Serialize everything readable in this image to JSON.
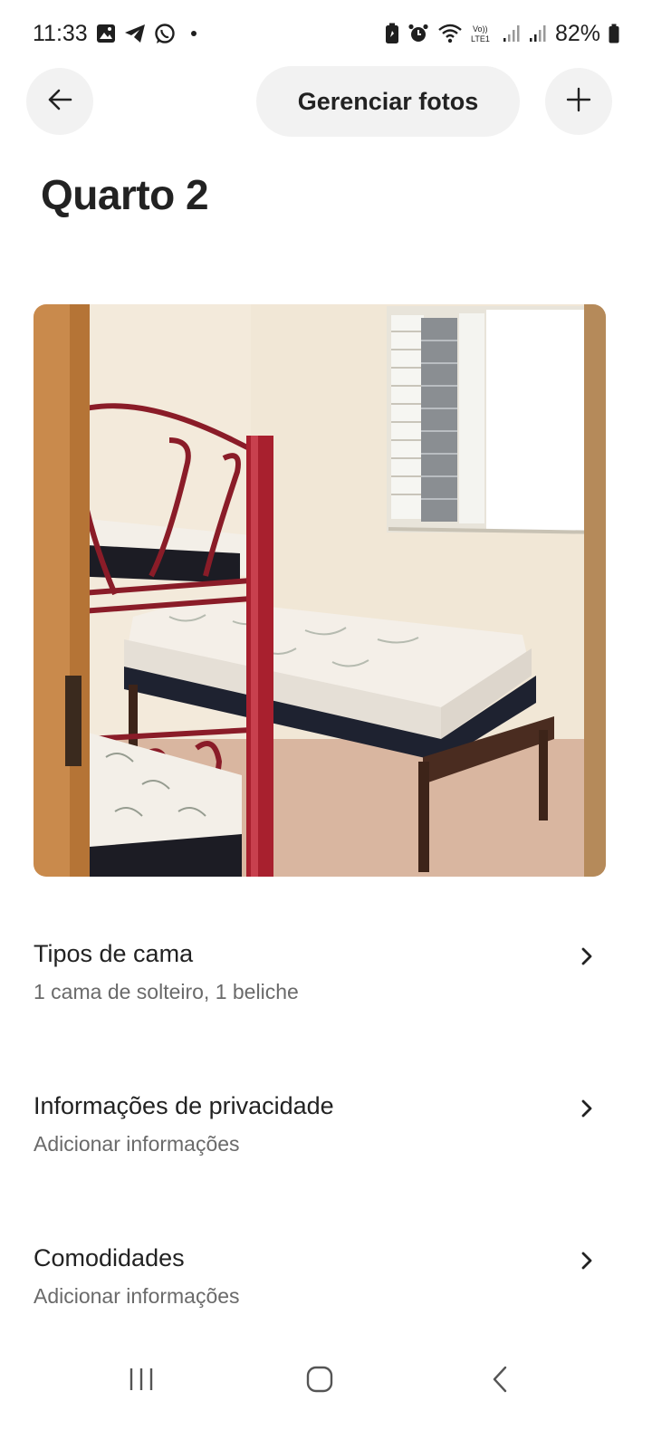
{
  "status_bar": {
    "time": "11:33",
    "battery": "82%",
    "icons_left": [
      "gallery-icon",
      "telegram-icon",
      "whatsapp-icon",
      "dot-icon"
    ],
    "icons_right": [
      "battery-saver-icon",
      "alarm-icon",
      "wifi-icon",
      "volte-icon",
      "signal-icon",
      "signal-icon",
      "battery-icon"
    ],
    "volte_label": "Vo)) LTE1"
  },
  "header": {
    "manage_photos_label": "Gerenciar fotos",
    "back_icon": "arrow-left-icon",
    "add_icon": "plus-icon"
  },
  "page": {
    "title": "Quarto 2"
  },
  "photo": {
    "description_icon": "bedroom-photo"
  },
  "items": [
    {
      "title": "Tipos de cama",
      "subtitle": "1 cama de solteiro, 1 beliche"
    },
    {
      "title": "Informações de privacidade",
      "subtitle": "Adicionar informações"
    },
    {
      "title": "Comodidades",
      "subtitle": "Adicionar informações"
    }
  ],
  "nav": {
    "icons": [
      "recent-apps-icon",
      "home-icon",
      "back-icon"
    ]
  },
  "colors": {
    "text_primary": "#222222",
    "text_secondary": "#6a6a6a",
    "button_bg": "#f2f2f2"
  }
}
